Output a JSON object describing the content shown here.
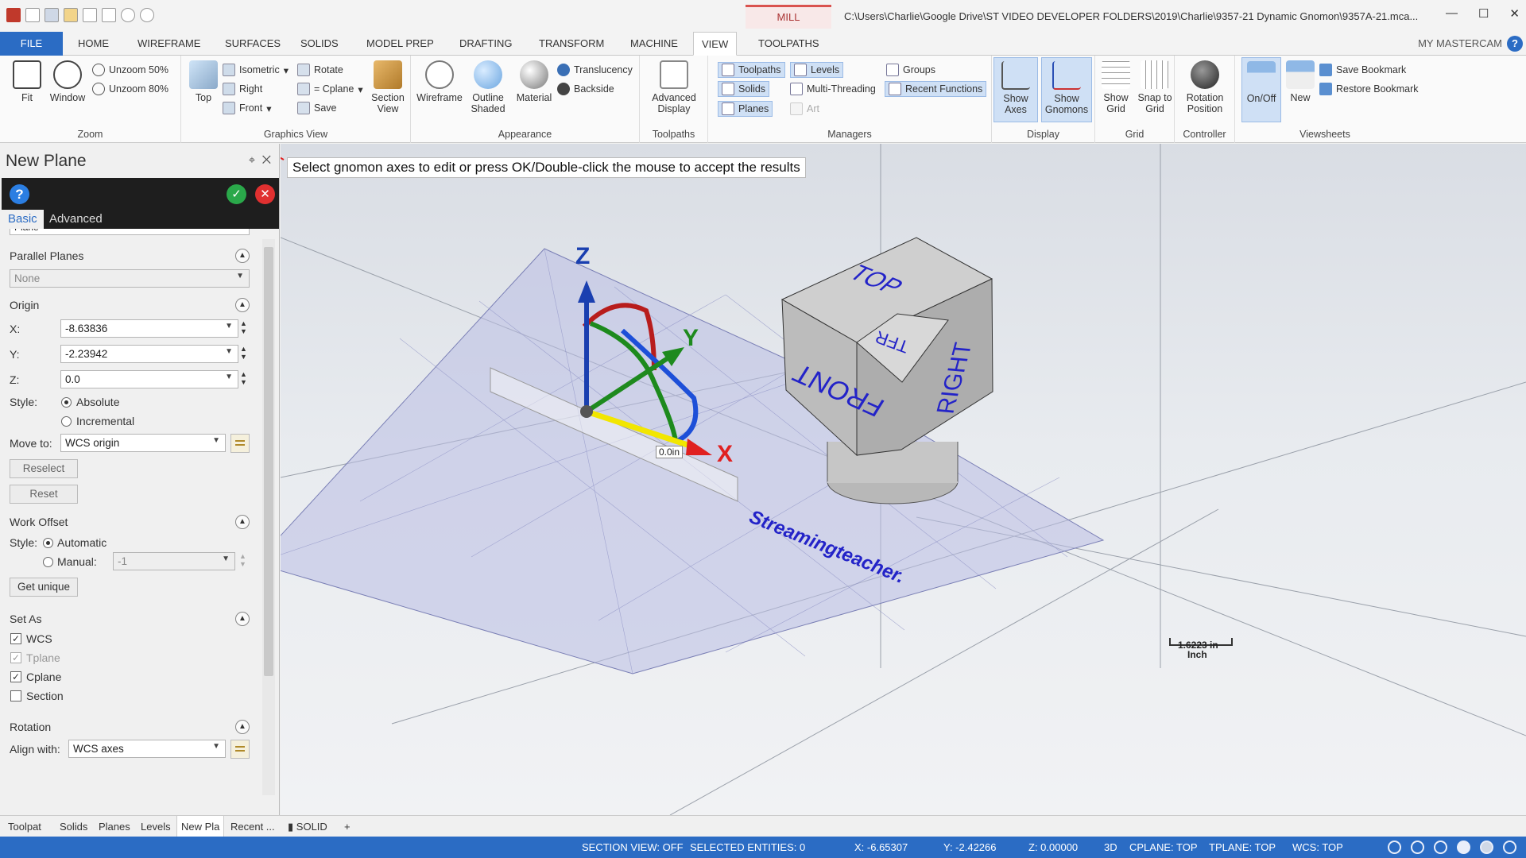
{
  "title": {
    "context_tab": "MILL",
    "window_title": "C:\\Users\\Charlie\\Google Drive\\ST VIDEO DEVELOPER FOLDERS\\2019\\Charlie\\9357-21 Dynamic Gnomon\\9357A-21.mca..."
  },
  "ribbon_tabs": [
    "FILE",
    "HOME",
    "WIREFRAME",
    "SURFACES",
    "SOLIDS",
    "MODEL PREP",
    "DRAFTING",
    "TRANSFORM",
    "MACHINE",
    "VIEW",
    "TOOLPATHS"
  ],
  "my_mastercam": "MY MASTERCAM",
  "groups": {
    "zoom": {
      "label": "Zoom",
      "fit": "Fit",
      "window": "Window",
      "unzoom50": "Unzoom 50%",
      "unzoom80": "Unzoom 80%"
    },
    "graphics_view": {
      "label": "Graphics View",
      "top": "Top",
      "isometric": "Isometric",
      "right": "Right",
      "front": "Front",
      "rotate": "Rotate",
      "cplane": "= Cplane",
      "save": "Save",
      "section_view": "Section View"
    },
    "appearance": {
      "label": "Appearance",
      "wireframe": "Wireframe",
      "outline_shaded": "Outline Shaded",
      "material": "Material",
      "translucency": "Translucency",
      "backside": "Backside"
    },
    "toolpaths": {
      "label": "Toolpaths",
      "advanced_display": "Advanced Display"
    },
    "managers": {
      "label": "Managers",
      "toolpaths": "Toolpaths",
      "solids": "Solids",
      "planes": "Planes",
      "levels": "Levels",
      "multi_threading": "Multi-Threading",
      "art": "Art",
      "groups": "Groups",
      "recent_functions": "Recent Functions"
    },
    "display": {
      "label": "Display",
      "show_axes": "Show Axes",
      "show_gnomons": "Show Gnomons"
    },
    "grid": {
      "label": "Grid",
      "show_grid": "Show Grid",
      "snap_to_grid": "Snap to Grid"
    },
    "controller": {
      "label": "Controller",
      "rotation_position": "Rotation Position"
    },
    "viewsheets": {
      "label": "Viewsheets",
      "onoff": "On/Off",
      "new": "New",
      "save_bookmark": "Save Bookmark",
      "restore_bookmark": "Restore Bookmark"
    }
  },
  "panel": {
    "title": "New Plane",
    "tabs": [
      "Basic",
      "Advanced"
    ],
    "cut_label": "Plane",
    "parallel_planes": {
      "heading": "Parallel Planes",
      "value": "None"
    },
    "origin": {
      "heading": "Origin",
      "x_label": "X:",
      "x": "-8.63836",
      "y_label": "Y:",
      "y": "-2.23942",
      "z_label": "Z:",
      "z": "0.0",
      "style_label": "Style:",
      "absolute": "Absolute",
      "incremental": "Incremental",
      "move_to_label": "Move to:",
      "move_to": "WCS origin",
      "reselect": "Reselect",
      "reset": "Reset"
    },
    "work_offset": {
      "heading": "Work Offset",
      "style_label": "Style:",
      "automatic": "Automatic",
      "manual": "Manual:",
      "manual_value": "-1",
      "get_unique": "Get unique"
    },
    "set_as": {
      "heading": "Set As",
      "wcs": "WCS",
      "tplane": "Tplane",
      "cplane": "Cplane",
      "section": "Section"
    },
    "rotation": {
      "heading": "Rotation",
      "align_label": "Align with:",
      "align": "WCS axes"
    }
  },
  "viewport": {
    "prompt": "Select gnomon axes to edit or press OK/Double-click the mouse to accept the results",
    "cube_faces": {
      "top": "TOP",
      "front": "FRONT",
      "right": "RIGHT",
      "corner": "TFR"
    },
    "watermark": "Streamingteacher.",
    "dimension_readout": "0.0in",
    "scale_value": "1.6223 in",
    "scale_unit": "Inch",
    "axis_x": "X",
    "axis_y": "Y",
    "axis_z": "Z"
  },
  "bottom_tabs": [
    "Toolpat",
    "Solids",
    "Planes",
    "Levels",
    "New Pla",
    "Recent ..."
  ],
  "viewsheet_tab": "SOLID",
  "viewsheet_add": "+",
  "status": {
    "section_view": "SECTION VIEW: OFF",
    "selected": "SELECTED ENTITIES: 0",
    "x": "X:  -6.65307",
    "y": "Y:  -2.42266",
    "z": "Z:  0.00000",
    "mode": "3D",
    "cplane": "CPLANE: TOP",
    "tplane": "TPLANE: TOP",
    "wcs": "WCS: TOP"
  },
  "colors": {
    "accent": "#2b6cc4",
    "x_axis": "#e02020",
    "y_axis": "#1e8a1e",
    "z_axis": "#1a3fb0",
    "drag_arrow": "#f2e600"
  }
}
